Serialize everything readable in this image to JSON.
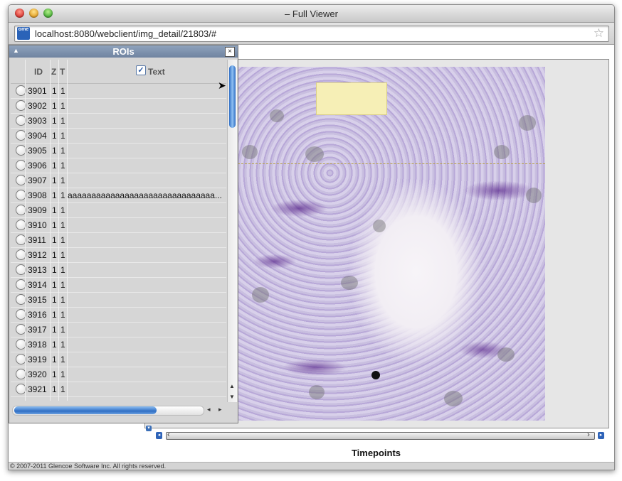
{
  "window": {
    "title": "– Full Viewer"
  },
  "browser": {
    "url": "localhost:8080/webclient/img_detail/21803/#",
    "favicon_text": "ome"
  },
  "roi_panel": {
    "title": "ROIs",
    "close_glyph": "×",
    "columns": {
      "id": "ID",
      "z": "Z",
      "t": "T",
      "text": "Text"
    },
    "rows": [
      {
        "id": "3901",
        "z": "1",
        "t": "1",
        "text": ""
      },
      {
        "id": "3902",
        "z": "1",
        "t": "1",
        "text": ""
      },
      {
        "id": "3903",
        "z": "1",
        "t": "1",
        "text": ""
      },
      {
        "id": "3904",
        "z": "1",
        "t": "1",
        "text": ""
      },
      {
        "id": "3905",
        "z": "1",
        "t": "1",
        "text": ""
      },
      {
        "id": "3906",
        "z": "1",
        "t": "1",
        "text": ""
      },
      {
        "id": "3907",
        "z": "1",
        "t": "1",
        "text": ""
      },
      {
        "id": "3908",
        "z": "1",
        "t": "1",
        "text": "aaaaaaaaaaaaaaaaaaaaaaaaaaaaaaa..."
      },
      {
        "id": "3909",
        "z": "1",
        "t": "1",
        "text": ""
      },
      {
        "id": "3910",
        "z": "1",
        "t": "1",
        "text": ""
      },
      {
        "id": "3911",
        "z": "1",
        "t": "1",
        "text": ""
      },
      {
        "id": "3912",
        "z": "1",
        "t": "1",
        "text": ""
      },
      {
        "id": "3913",
        "z": "1",
        "t": "1",
        "text": ""
      },
      {
        "id": "3914",
        "z": "1",
        "t": "1",
        "text": ""
      },
      {
        "id": "3915",
        "z": "1",
        "t": "1",
        "text": ""
      },
      {
        "id": "3916",
        "z": "1",
        "t": "1",
        "text": ""
      },
      {
        "id": "3917",
        "z": "1",
        "t": "1",
        "text": ""
      },
      {
        "id": "3918",
        "z": "1",
        "t": "1",
        "text": ""
      },
      {
        "id": "3919",
        "z": "1",
        "t": "1",
        "text": ""
      },
      {
        "id": "3920",
        "z": "1",
        "t": "1",
        "text": ""
      },
      {
        "id": "3921",
        "z": "1",
        "t": "1",
        "text": ""
      }
    ]
  },
  "viewer": {
    "time_axis_label": "Timepoints"
  },
  "footer": {
    "copyright": "© 2007-2011 Glencoe Software Inc. All rights reserved."
  },
  "colors": {
    "accent": "#2f6ec4",
    "stain": "#7a5cb0",
    "note": "#f6efb6"
  },
  "icons": [
    "close-icon",
    "collapse-icon",
    "checkbox-icon",
    "bookmark-star-icon",
    "scroll-left-icon",
    "scroll-right-icon",
    "scroll-up-icon",
    "scroll-down-icon"
  ]
}
